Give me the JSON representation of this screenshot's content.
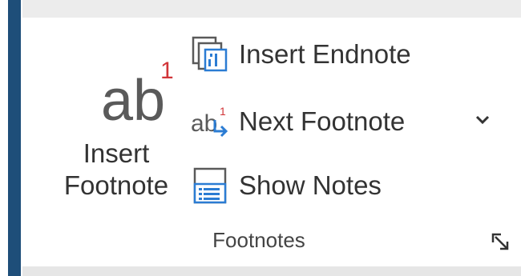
{
  "ribbon_group": {
    "name": "Footnotes",
    "insert_footnote": {
      "label_line1": "Insert",
      "label_line2": "Footnote",
      "icon_text": "ab",
      "icon_superscript": "1",
      "icon": "insert-footnote-icon"
    },
    "insert_endnote": {
      "label": "Insert Endnote",
      "icon": "insert-endnote-icon"
    },
    "next_footnote": {
      "label": "Next Footnote",
      "icon": "next-footnote-icon",
      "icon_text": "ab",
      "icon_superscript": "1"
    },
    "show_notes": {
      "label": "Show Notes",
      "icon": "show-notes-icon"
    }
  },
  "colors": {
    "accent_blue": "#1e4e79",
    "icon_blue": "#2b7cd3",
    "superscript_red": "#d13438",
    "text": "#333333",
    "icon_gray": "#5a5a5a"
  }
}
